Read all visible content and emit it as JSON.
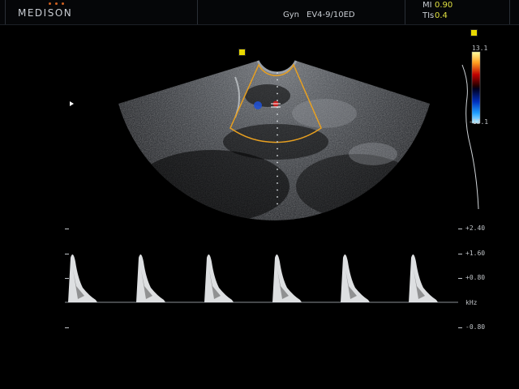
{
  "header": {
    "logo": "MEDISON",
    "preset": "Gyn",
    "probe": "EV4-9/10ED",
    "mi_label": "MI",
    "mi_value": "0.90",
    "tis_label": "TIs",
    "tis_value": "0.4"
  },
  "color_bar": {
    "top_label": "13.1",
    "bottom_label": "-13.1"
  },
  "doppler_scale": {
    "labels": [
      "+2.40",
      "+1.60",
      "+0.80",
      "kHz",
      "-0.80"
    ],
    "unit": "kHz",
    "peak_count": 6
  },
  "colors": {
    "brand_accent": "#d06020",
    "indicator": "#e8d800",
    "roi_box": "#e8a020",
    "value_text": "#e0e040"
  },
  "icons": {
    "pointer": "arrow-pointer-icon",
    "marker": "yellow-square-marker-icon"
  }
}
